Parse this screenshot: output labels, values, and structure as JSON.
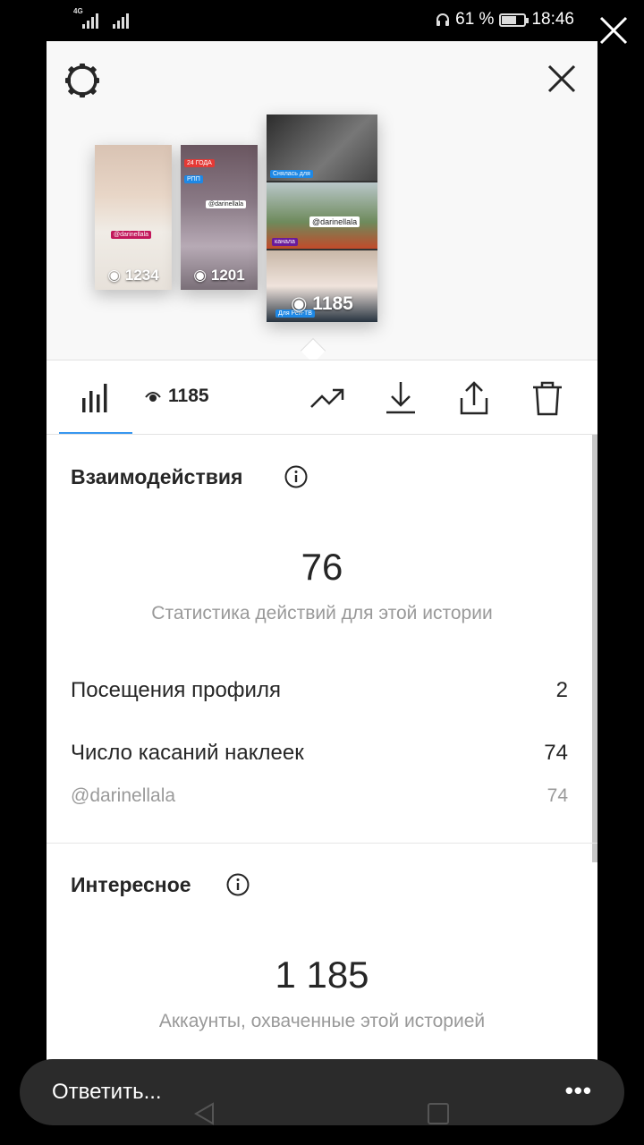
{
  "status_bar": {
    "network_1": "4G",
    "network_2": "",
    "battery_percent": "61 %",
    "time": "18:46"
  },
  "stories": [
    {
      "views": "1234"
    },
    {
      "views": "1201"
    },
    {
      "views": "1185"
    }
  ],
  "story_stickers": {
    "s1_tag": "@darinellala",
    "s2_tag": "@darinellala",
    "s2_top": "24 ГОДА",
    "s2_rpp": "РПП",
    "s3_top": "Снялась для",
    "s3_tag": "@darinellala",
    "s3_channel": "канала",
    "s3_bottom": "Для Рен-ТВ"
  },
  "toolbar": {
    "views": "1185",
    "icons": [
      "bar-chart-icon",
      "eye-icon",
      "trending-icon",
      "download-icon",
      "share-icon",
      "trash-icon"
    ]
  },
  "interactions": {
    "title": "Взаимодействия",
    "total": "76",
    "subtitle": "Статистика действий для этой истории",
    "rows": [
      {
        "label": "Посещения профиля",
        "value": "2"
      },
      {
        "label": "Число касаний наклеек",
        "value": "74"
      }
    ],
    "sub_rows": [
      {
        "label": "@darinellala",
        "value": "74"
      }
    ]
  },
  "discovery": {
    "title": "Интересное",
    "total": "1 185",
    "subtitle": "Аккаунты, охваченные этой историей"
  },
  "reply_bar": {
    "placeholder": "Ответить...",
    "more": "•••"
  },
  "colors": {
    "accent": "#3897f0",
    "text": "#262626",
    "muted": "#999999"
  }
}
